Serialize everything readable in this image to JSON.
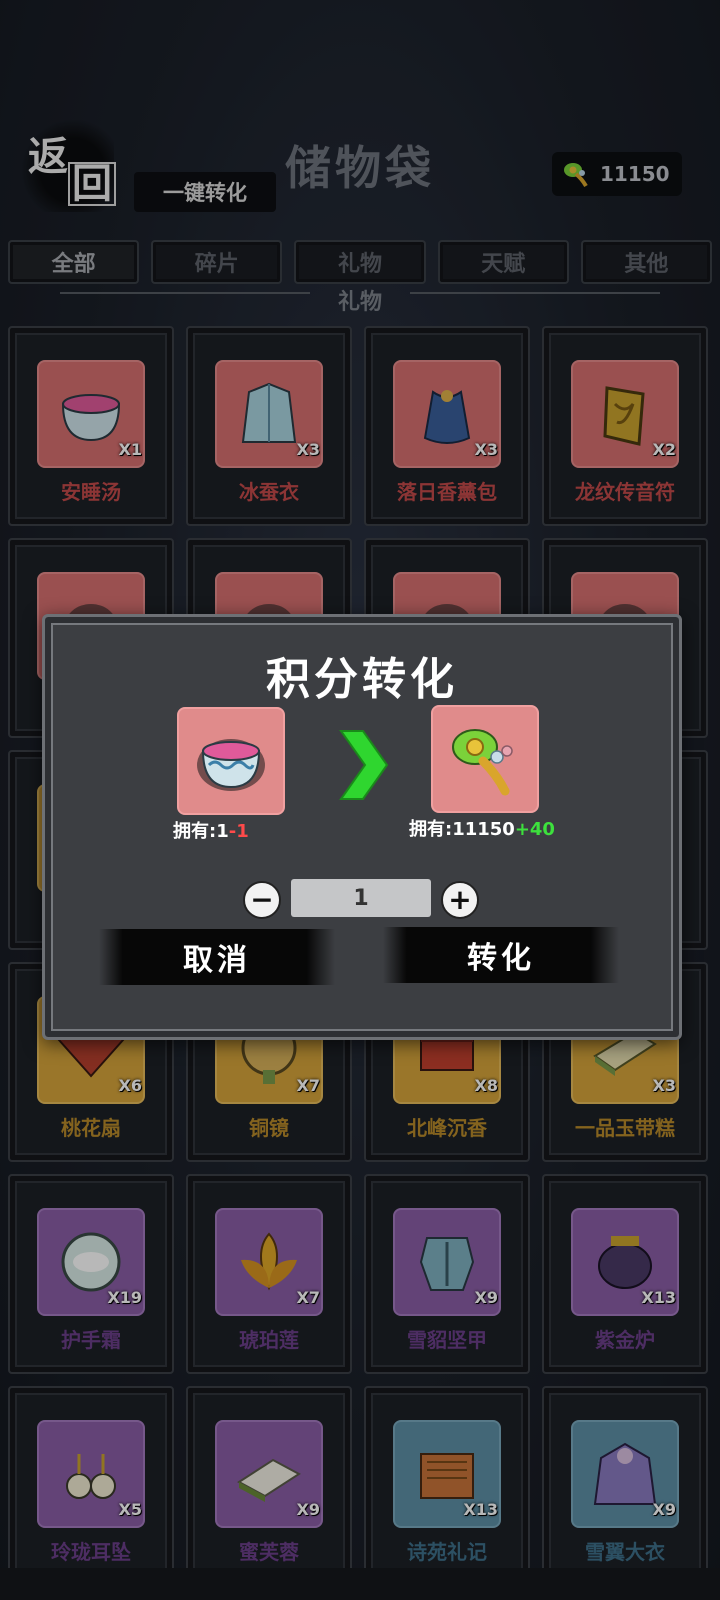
{
  "header": {
    "back_label_1": "返",
    "back_label_2": "回",
    "one_click_label": "一键转化",
    "title": "储物袋",
    "currency_icon": "jade-ruyi-icon",
    "currency_value": "11150"
  },
  "tabs": [
    {
      "label": "全部",
      "active": true
    },
    {
      "label": "碎片",
      "active": false
    },
    {
      "label": "礼物",
      "active": false
    },
    {
      "label": "天赋",
      "active": false
    },
    {
      "label": "其他",
      "active": false
    }
  ],
  "section_title": "礼物",
  "items": [
    {
      "name": "安睡汤",
      "qty": "X1",
      "rarity": "red",
      "icon": "soup-bowl-icon"
    },
    {
      "name": "冰蚕衣",
      "qty": "X3",
      "rarity": "red",
      "icon": "silk-robe-icon"
    },
    {
      "name": "落日香薰包",
      "qty": "X3",
      "rarity": "red",
      "icon": "sachet-icon"
    },
    {
      "name": "龙纹传音符",
      "qty": "X2",
      "rarity": "red",
      "icon": "dragon-talisman-icon"
    },
    {
      "name": "",
      "qty": "",
      "rarity": "red",
      "icon": "hidden-item-icon"
    },
    {
      "name": "",
      "qty": "",
      "rarity": "red",
      "icon": "hidden-item-icon"
    },
    {
      "name": "",
      "qty": "",
      "rarity": "red",
      "icon": "hidden-item-icon"
    },
    {
      "name": "",
      "qty": "",
      "rarity": "red",
      "icon": "hidden-item-icon"
    },
    {
      "name": "",
      "qty": "",
      "rarity": "yellow",
      "icon": "hidden-item-icon"
    },
    {
      "name": "",
      "qty": "",
      "rarity": "yellow",
      "icon": "hidden-item-icon"
    },
    {
      "name": "",
      "qty": "",
      "rarity": "yellow",
      "icon": "hidden-item-icon"
    },
    {
      "name": "",
      "qty": "",
      "rarity": "yellow",
      "icon": "hidden-item-icon"
    },
    {
      "name": "桃花扇",
      "qty": "X6",
      "rarity": "yellow",
      "icon": "folding-fan-icon"
    },
    {
      "name": "铜镜",
      "qty": "X7",
      "rarity": "yellow",
      "icon": "bronze-mirror-icon"
    },
    {
      "name": "北峰沉香",
      "qty": "X8",
      "rarity": "yellow",
      "icon": "incense-box-icon"
    },
    {
      "name": "一品玉带糕",
      "qty": "X3",
      "rarity": "yellow",
      "icon": "jade-cake-icon"
    },
    {
      "name": "护手霜",
      "qty": "X19",
      "rarity": "purple",
      "icon": "cream-jar-icon"
    },
    {
      "name": "琥珀莲",
      "qty": "X7",
      "rarity": "purple",
      "icon": "amber-lotus-icon"
    },
    {
      "name": "雪貂坚甲",
      "qty": "X9",
      "rarity": "purple",
      "icon": "armor-icon"
    },
    {
      "name": "紫金炉",
      "qty": "X13",
      "rarity": "purple",
      "icon": "censer-icon"
    },
    {
      "name": "玲珑耳坠",
      "qty": "X5",
      "rarity": "purple",
      "icon": "earrings-icon"
    },
    {
      "name": "蜜芙蓉",
      "qty": "X9",
      "rarity": "purple",
      "icon": "pastry-icon"
    },
    {
      "name": "诗苑礼记",
      "qty": "X13",
      "rarity": "blue",
      "icon": "scroll-icon"
    },
    {
      "name": "雪翼大衣",
      "qty": "X9",
      "rarity": "blue",
      "icon": "cloak-icon"
    }
  ],
  "modal": {
    "title": "积分转化",
    "source_icon": "soup-bowl-icon",
    "source_owned_label": "拥有:1",
    "source_delta": "-1",
    "target_icon": "jade-ruyi-icon",
    "target_owned_label": "拥有:11150",
    "target_delta": "+40",
    "quantity": "1",
    "minus_label": "−",
    "plus_label": "+",
    "cancel_label": "取消",
    "convert_label": "转化"
  },
  "colors": {
    "red_frame": "#d66f6f",
    "yellow_frame": "#d6a43b",
    "purple_frame": "#8a5ea5",
    "blue_frame": "#5d8fa6",
    "positive": "#3de03d",
    "negative": "#ff4a4a",
    "arrow_green": "#2fd62f"
  }
}
